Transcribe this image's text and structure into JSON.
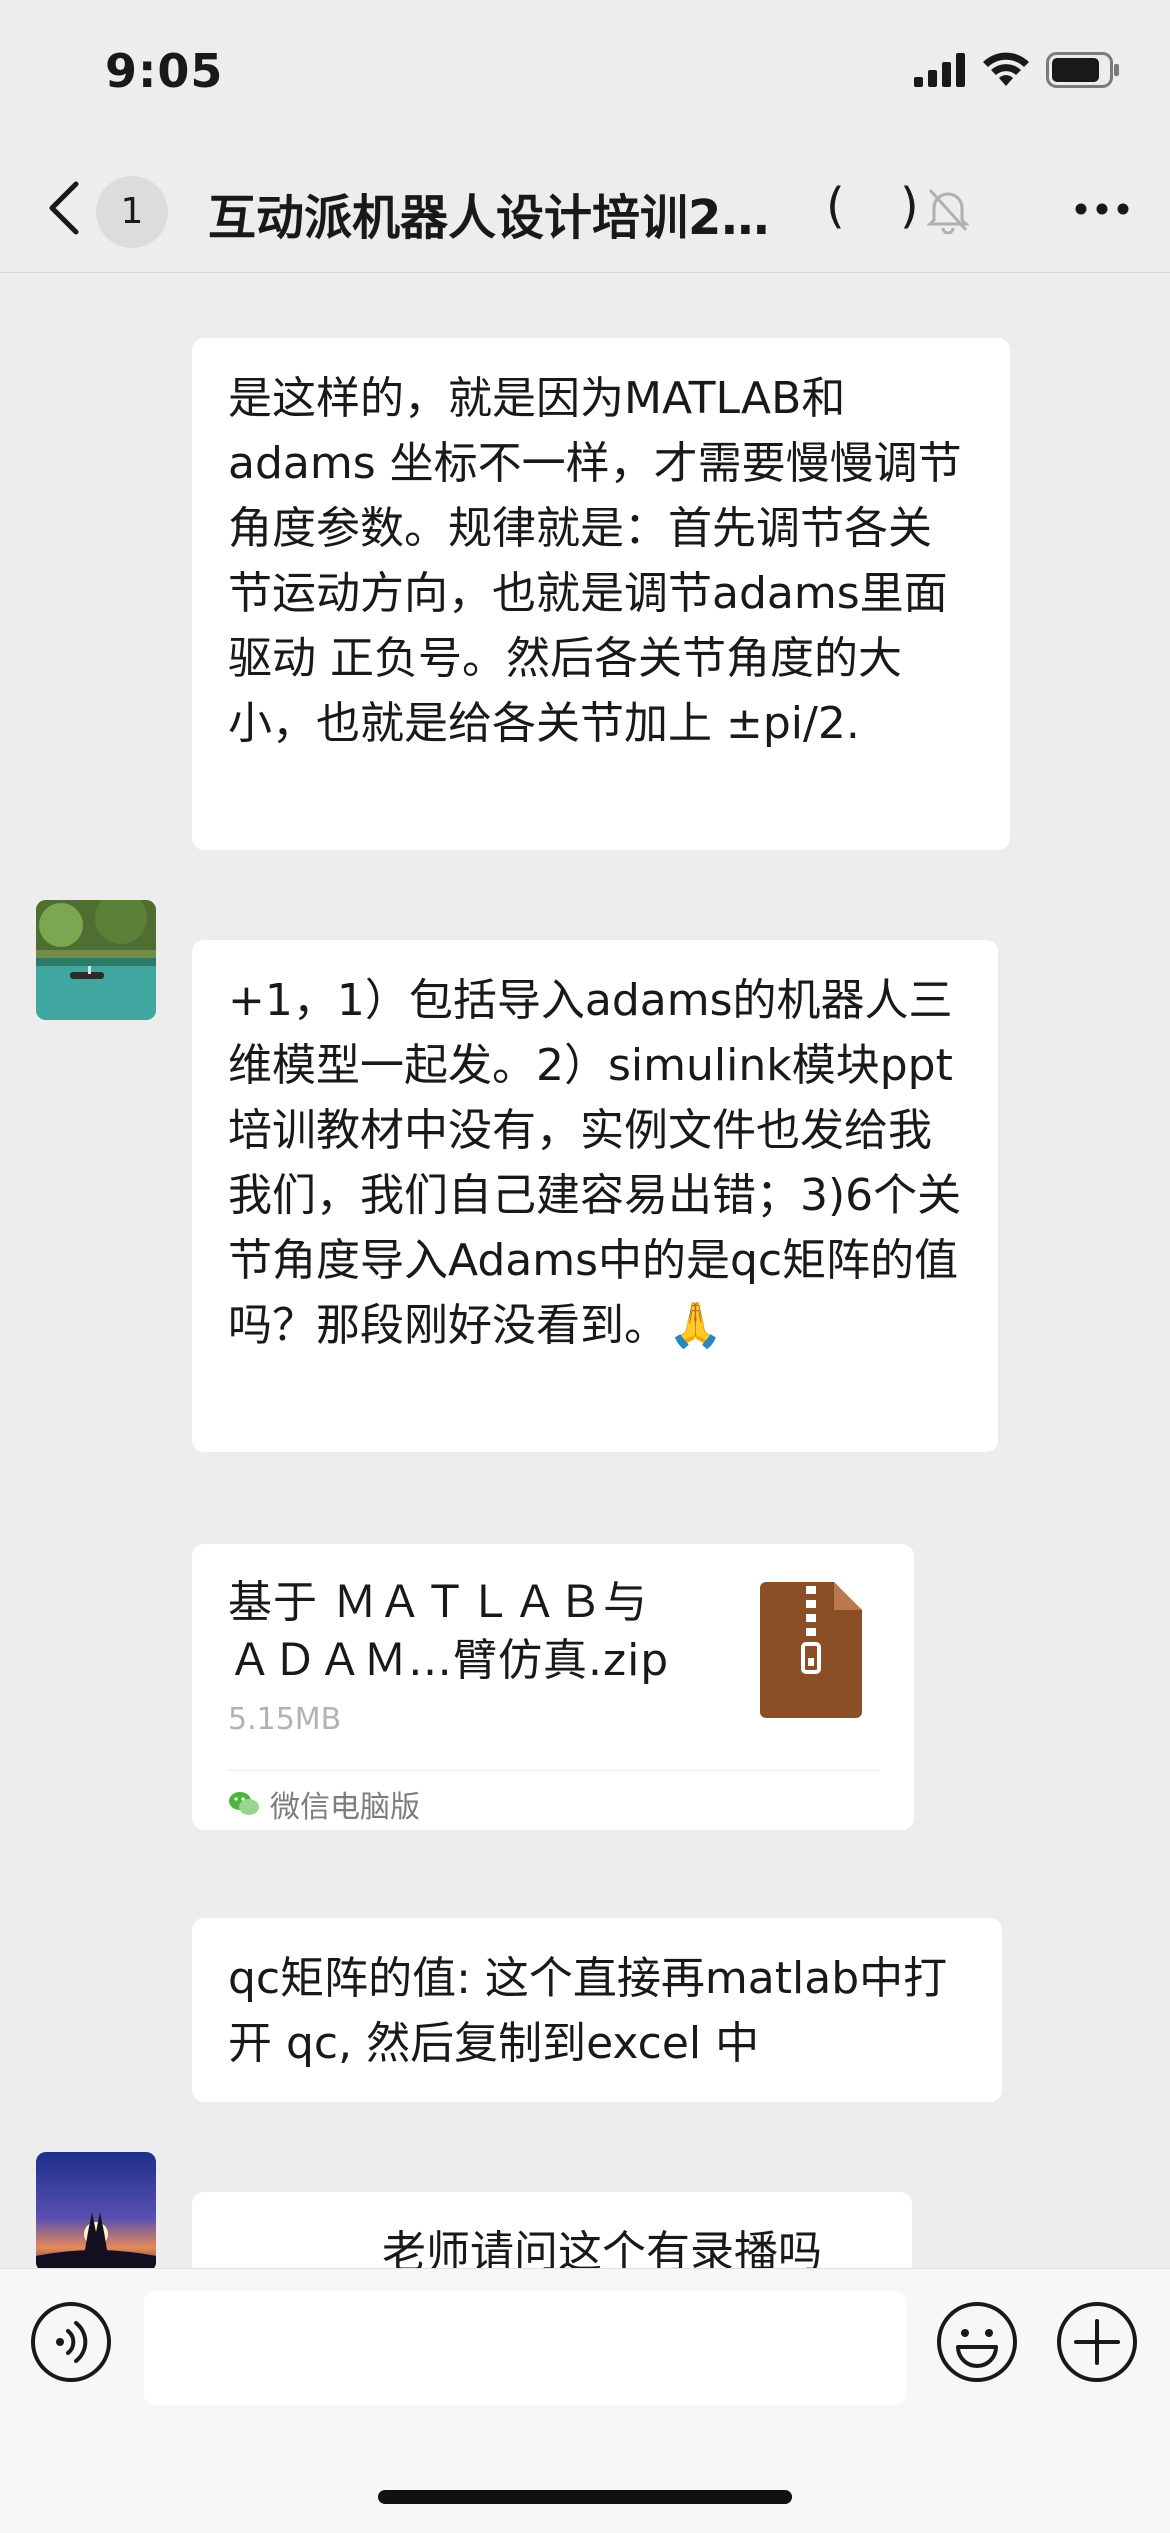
{
  "status_bar": {
    "time": "9:05"
  },
  "header": {
    "unread_count": "1",
    "chat_title": "互动派机器人设计培训2…",
    "paren_open": "(",
    "paren_close": ")"
  },
  "messages": [
    {
      "text": "是这样的，就是因为MATLAB和adams 坐标不一样，才需要慢慢调节角度参数。规律就是：首先调节各关节运动方向，也就是调节adams里面驱动 正负号。然后各关节角度的大小，也就是给各关节加上 ±pi/2."
    },
    {
      "text": "+1，1）包括导入adams的机器人三维模型一起发。2）simulink模块ppt培训教材中没有，实例文件也发给我我们，我们自己建容易出错；3)6个关节角度导入Adams中的是qc矩阵的值吗？那段刚好没看到。🙏"
    },
    {
      "text": "qc矩阵的值: 这个直接再matlab中打开 qc, 然后复制到excel 中"
    },
    {
      "text": "老师请问这个有录播吗"
    }
  ],
  "file": {
    "name": "基于 ＭＡＴＬＡＢ与\nＡＤＡＭ…臂仿真.zip",
    "size": "5.15MB",
    "source": "微信电脑版"
  },
  "colors": {
    "background": "#ededed",
    "bubble": "#ffffff",
    "file_icon": "#8b4f27"
  }
}
